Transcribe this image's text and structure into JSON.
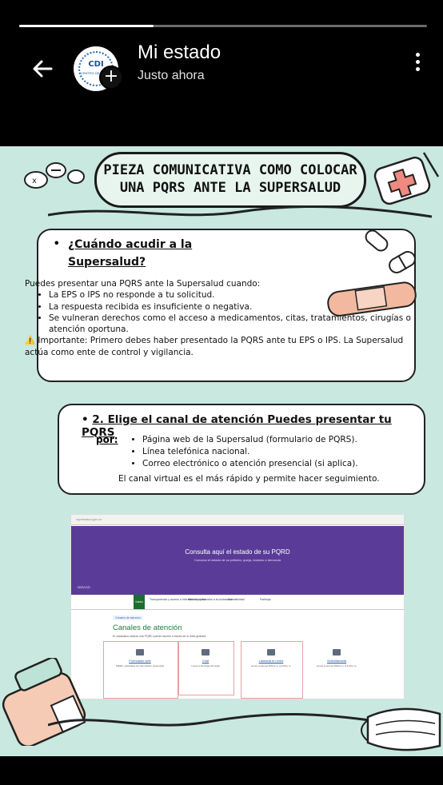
{
  "status": {
    "title": "Mi estado",
    "subtitle": "Justo ahora",
    "progress": 0.33
  },
  "avatar": {
    "line1": "CDI",
    "line2": "CENTRO DE SALUD"
  },
  "post": {
    "heading": [
      "PIEZA COMUNICATIVA COMO COLOCAR",
      "UNA PQRS ANTE LA SUPERSALUD"
    ],
    "card1": {
      "title1": "¿Cuándo acudir a la",
      "title2": "Supersalud?",
      "intro": "Puedes presentar una PQRS ante la Supersalud cuando:",
      "bullets": [
        "La EPS o IPS no responde a tu solicitud.",
        "La respuesta recibida es insuficiente o negativa.",
        "Se vulneran derechos como el acceso a medicamentos, citas, tratamientos, cirugías o atención oportuna."
      ],
      "important": "⚠️ Importante: Primero debes haber presentado la PQRS ante tu EPS o IPS. La Supersalud actúa como ente de control y vigilancia."
    },
    "card2": {
      "num": "2. Elige el canal de atención",
      "title_rest": " Puedes presentar tu PQRS",
      "por": "por:",
      "bullets": [
        "Página web de la Supersalud (formulario de PQRS).",
        "Línea telefónica nacional.",
        "Correo electrónico o atención presencial (si aplica)."
      ],
      "footer": "El canal virtual es el más rápido y permite hacer seguimiento."
    },
    "screenshot": {
      "url": "supersalud.gov.co",
      "banner_title": "Consulta aquí el estado de su PQRD",
      "banner_sub": "Conozca el estado de su petición, queja, reclamo o denuncia",
      "gov": "GOV.CO",
      "nav_home": "Inicio",
      "nav_links": [
        "Transparencia y acceso a información pública",
        "Atención y servicios a la ciudadanía",
        "Normatividad",
        "Participa"
      ],
      "crumb": "Canales de atención",
      "channels_title": "Canales de atención",
      "channels_sub": "El ciudadano radicar una PQRD puede hacerlo a través de la línea gratuita",
      "channels": [
        {
          "name": "Formulario web",
          "desc": "PQRD, solicitudes de información, denuncias"
        },
        {
          "name": "Chat",
          "desc": "Lunes a domingo 24 horas"
        },
        {
          "name": "Llamada en línea",
          "desc": "Lunes a viernes 8:00 a.m. a 6:00 p.m."
        },
        {
          "name": "Videollamada",
          "desc": "Lunes a viernes 8:00 a.m. a 5:00 p.m."
        }
      ]
    }
  }
}
